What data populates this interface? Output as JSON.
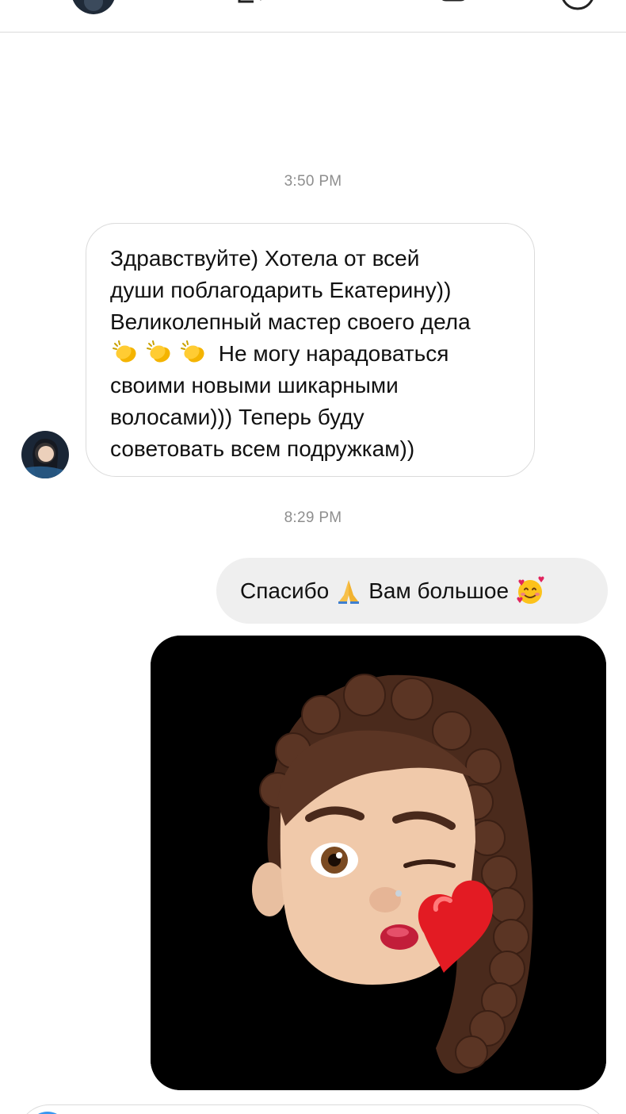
{
  "conversation": {
    "messages": [
      {
        "timestamp": "3:50 PM",
        "direction": "incoming",
        "lines": [
          "Здравствуйте) Хотела от всей",
          "души поблагодарить Екатерину))",
          "Великолепный мастер своего дела",
          "Не могу нарадоваться",
          "своими новыми шикарными",
          "волосами))) Теперь буду",
          "советовать всем подружкам))"
        ],
        "inline_emoji": "clapping-hands x3"
      },
      {
        "timestamp": "8:29 PM",
        "direction": "outgoing",
        "text_before": "Спасибо",
        "text_middle": "Вам большое",
        "emoji_1": "folded-hands",
        "emoji_2": "smiling-face-with-hearts"
      },
      {
        "direction": "outgoing",
        "type": "image",
        "image_subject": "memoji-kiss-heart"
      }
    ]
  },
  "colors": {
    "timestamp": "#8e8e8e",
    "incoming_bubble_border": "#dbdbdb",
    "outgoing_bubble_bg": "#efefef",
    "accent": "#3897f0"
  }
}
